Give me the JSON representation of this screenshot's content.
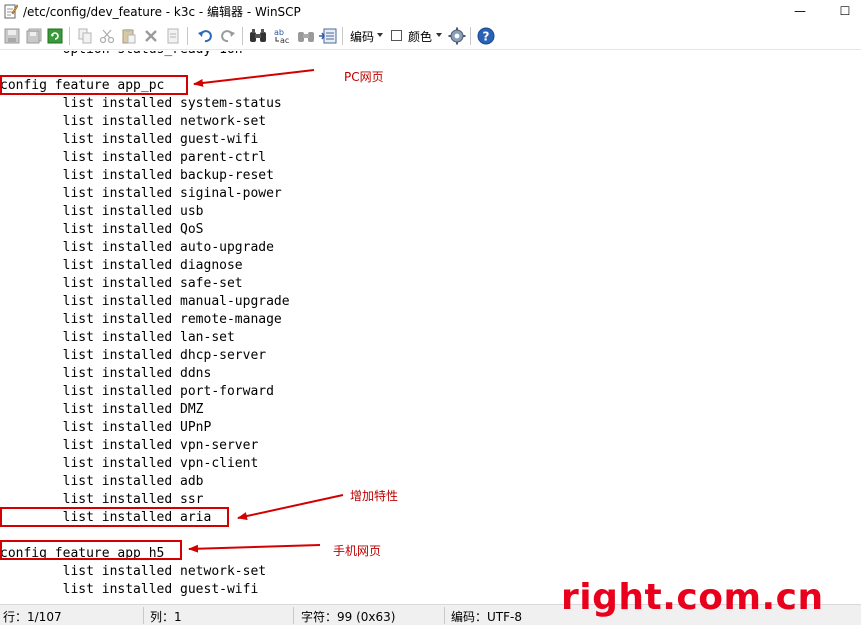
{
  "window": {
    "title": "/etc/config/dev_feature - k3c - 编辑器 - WinSCP",
    "minimize_glyph": "—",
    "maximize_glyph": "☐"
  },
  "toolbar": {
    "encoding_label": "编码",
    "color_label": "颜色",
    "icons": [
      "save-icon",
      "save-all-icon",
      "reload-icon",
      "copy-icon",
      "cut-icon",
      "paste-icon",
      "delete-icon",
      "undo-icon",
      "redo-icon",
      "find-icon",
      "replace-icon",
      "find-next-icon",
      "goto-line-icon",
      "settings-icon",
      "help-icon"
    ]
  },
  "editor": {
    "partial_top_line": "        option status_ready 1on",
    "lines": [
      "",
      "config feature app_pc",
      "        list installed system-status",
      "        list installed network-set",
      "        list installed guest-wifi",
      "        list installed parent-ctrl",
      "        list installed backup-reset",
      "        list installed siginal-power",
      "        list installed usb",
      "        list installed QoS",
      "        list installed auto-upgrade",
      "        list installed diagnose",
      "        list installed safe-set",
      "        list installed manual-upgrade",
      "        list installed remote-manage",
      "        list installed lan-set",
      "        list installed dhcp-server",
      "        list installed ddns",
      "        list installed port-forward",
      "        list installed DMZ",
      "        list installed UPnP",
      "        list installed vpn-server",
      "        list installed vpn-client",
      "        list installed adb",
      "        list installed ssr",
      "        list installed aria",
      "",
      "config feature app_h5",
      "        list installed network-set",
      "        list installed guest-wifi"
    ]
  },
  "annotations": {
    "pc_page": "PC网页",
    "added_feature": "增加特性",
    "mobile_page": "手机网页",
    "color": "#d40000"
  },
  "statusbar": {
    "line": "行：1/107",
    "column": "列：1",
    "char": "字符：99 (0x63)",
    "encoding": "编码：UTF-8"
  },
  "watermark": "right.com.cn"
}
